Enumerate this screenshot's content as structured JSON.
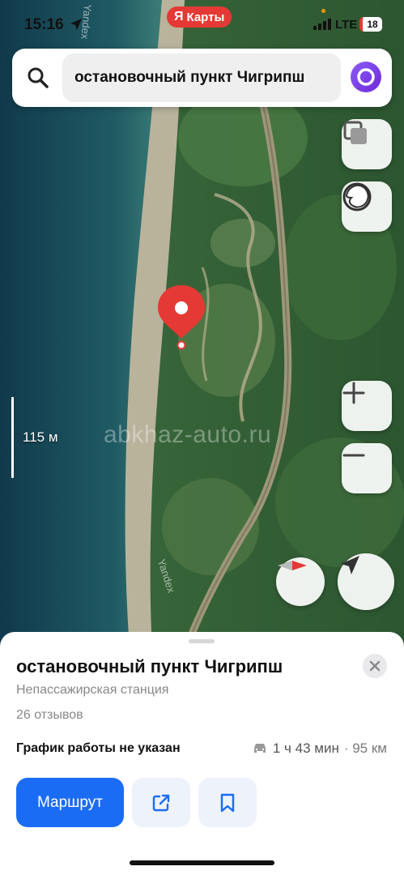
{
  "status_bar": {
    "time": "15:16",
    "network": "LTE",
    "battery": "18"
  },
  "app_badge": {
    "logo": "Я",
    "label": "Карты"
  },
  "search": {
    "query": "остановочный пункт Чигрипш"
  },
  "map": {
    "scale_label": "115 м",
    "watermark": "abkhaz-auto.ru",
    "road_label_top": "Yandex",
    "road_label_bottom": "Yandex"
  },
  "place": {
    "title": "остановочный пункт Чигрипш",
    "subtitle": "Непассажирская станция",
    "reviews": "26 отзывов",
    "hours": "График работы не указан",
    "route_time": "1 ч 43 мин",
    "route_distance": "· 95 км"
  },
  "actions": {
    "route_label": "Маршрут"
  },
  "colors": {
    "accent": "#1a6cf5",
    "marker": "#e53935",
    "alice": "#7c3aed"
  }
}
